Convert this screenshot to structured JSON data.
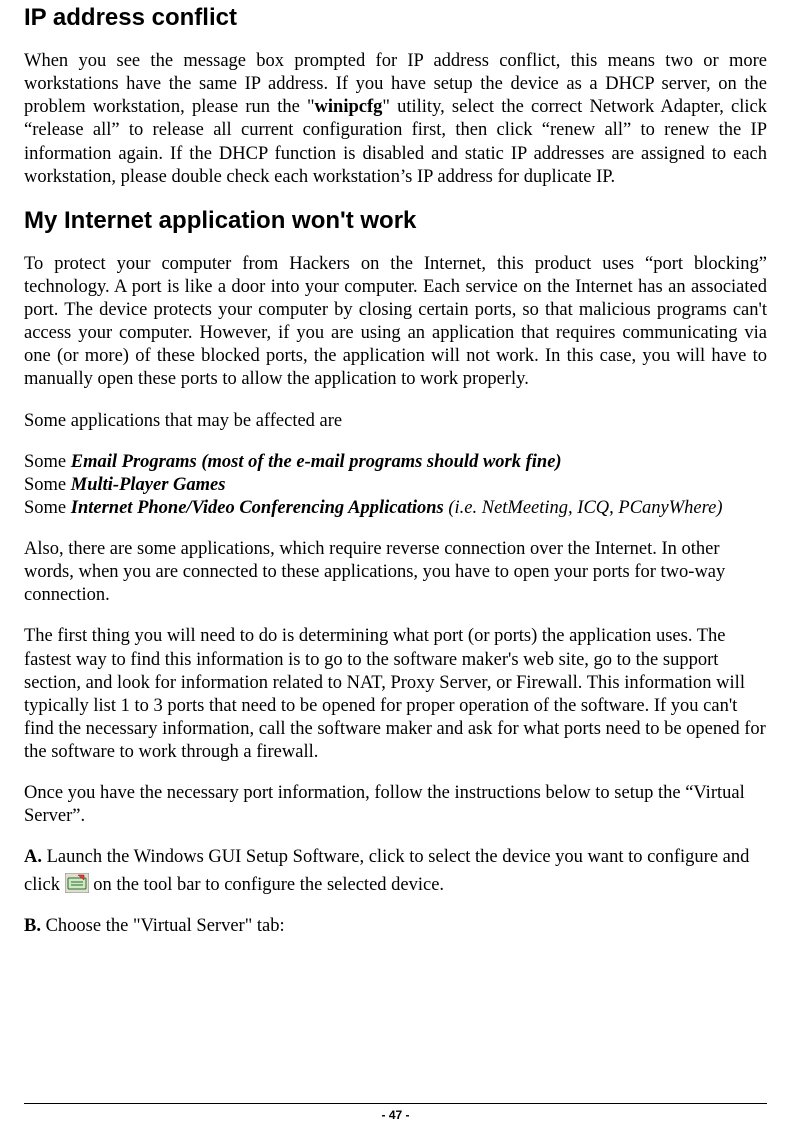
{
  "sections": {
    "ip_conflict": {
      "heading": "IP address conflict",
      "para1_pre": "When you see the message box prompted for IP address conflict, this means two or more workstations have the same IP address. If you have setup the device as a DHCP server, on the problem workstation, please run the \"",
      "bold_cmd": "winipcfg",
      "para1_post": "\" utility, select the correct Network Adapter, click “release all” to release all current configuration first, then click “renew all” to renew the IP information again. If the DHCP function is disabled and static IP addresses are assigned to each workstation, please double check each workstation’s IP address for duplicate IP."
    },
    "app_wont_work": {
      "heading": "My Internet application won't work",
      "para1": "To protect your computer from Hackers on the Internet, this product uses “port blocking” technology. A port is like a door into your computer. Each service on the Internet has an associated port. The device protects your computer by closing certain ports, so that malicious programs can't access your computer. However, if you are using an application that requires communicating via one (or more) of these blocked ports, the application will not work. In this case, you will have to manually open these ports to allow the application to work properly.",
      "affected_intro": "Some applications that may be affected are",
      "affected": [
        {
          "prefix": "Some ",
          "strong": "Email Programs  (most of the e-mail programs should work fine)",
          "tail": ""
        },
        {
          "prefix": "Some ",
          "strong": "Multi-Player Games",
          "tail": ""
        },
        {
          "prefix": "Some ",
          "strong": "Internet Phone/Video Conferencing Applications",
          "tail": "  (i.e. NetMeeting, ICQ, PCanyWhere)"
        }
      ],
      "para_reverse": "Also, there are some applications, which require reverse connection over the Internet. In other words, when you are connected to these applications, you have to open your ports for two-way connection.",
      "para_ports": "The first thing you will need to do is determining what port (or ports) the application uses. The fastest way to find this information is to go to the software maker's web site, go to the support section, and look for information related to NAT, Proxy Server, or Firewall. This information will typically list 1 to 3 ports that need to be opened for proper operation of the software. If you can't find the necessary information, call the software maker and ask for what ports need to be opened for the software to work through a firewall.",
      "para_once": "Once you have the necessary port information, follow the instructions below to setup the “Virtual Server”.",
      "stepA_label": "A.",
      "stepA_1": " Launch the Windows GUI Setup Software, click to select the device you want to configure and click ",
      "stepA_2": " on the tool bar to configure the selected device.",
      "stepB_label": "B.",
      "stepB": " Choose the \"Virtual Server\" tab:"
    }
  },
  "page_number": "- 47 -"
}
